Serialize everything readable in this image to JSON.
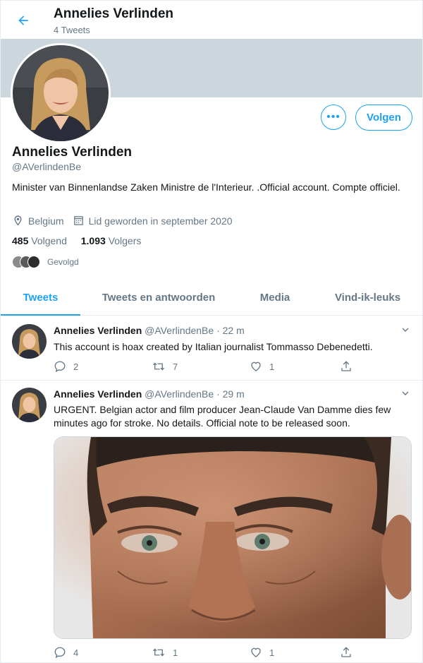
{
  "header": {
    "title": "Annelies Verlinden",
    "tweet_count": "4 Tweets"
  },
  "profile": {
    "name": "Annelies Verlinden",
    "handle": "@AVerlindenBe",
    "bio": "Minister van Binnenlandse Zaken  Ministre de l'Interieur. .Official account. Compte officiel.",
    "location": "Belgium",
    "joined": "Lid geworden in september 2020",
    "following_count": "485",
    "following_label": "Volgend",
    "followers_count": "1.093",
    "followers_label": "Volgers",
    "followed_by_label": "Gevolgd",
    "follow_button": "Volgen",
    "more_button": "•••"
  },
  "tabs": [
    {
      "label": "Tweets",
      "active": true
    },
    {
      "label": "Tweets en antwoorden",
      "active": false
    },
    {
      "label": "Media",
      "active": false
    },
    {
      "label": "Vind-ik-leuks",
      "active": false
    }
  ],
  "tweets": [
    {
      "name": "Annelies Verlinden",
      "handle": "@AVerlindenBe",
      "time": "· 22 m",
      "text": "This account is hoax created by Italian journalist Tommasso Debenedetti.",
      "replies": "2",
      "retweets": "7",
      "likes": "1"
    },
    {
      "name": "Annelies Verlinden",
      "handle": "@AVerlindenBe",
      "time": "· 29 m",
      "text": "URGENT. Belgian actor and film producer Jean-Claude Van Damme dies few minutes ago for stroke. No details. Official note to be released soon.",
      "replies": "4",
      "retweets": "1",
      "likes": "1"
    }
  ],
  "colors": {
    "accent": "#1da1f2",
    "banner": "#ccd6dd",
    "muted": "#657786"
  }
}
